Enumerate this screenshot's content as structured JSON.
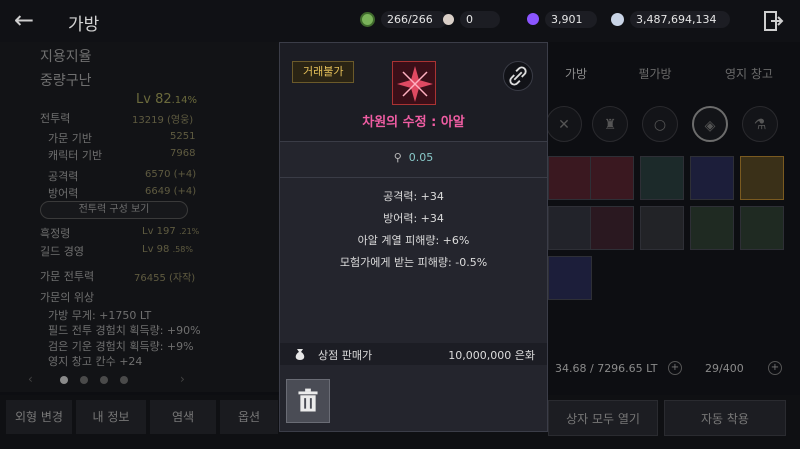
{
  "header": {
    "title": "가방",
    "currencies": [
      {
        "icon": "energy-icon",
        "value": "266/266",
        "color": "#7ab35a"
      },
      {
        "icon": "pearl-icon",
        "value": "0",
        "color": "#d9cfc7"
      },
      {
        "icon": "gem-icon",
        "value": "3,901",
        "color": "#8b55ff"
      },
      {
        "icon": "silver-icon",
        "value": "3,487,694,134",
        "color": "#c9d4e6"
      }
    ]
  },
  "left_panel": {
    "family_name": "지용지율",
    "character_name": "중량구난",
    "level": "Lv 82",
    "level_pct": ".14%",
    "combat_label": "전투력",
    "combat_value": "13219 (영웅)",
    "family_base_label": "가문 기반",
    "family_base_value": "5251",
    "char_base_label": "캐릭터 기반",
    "char_base_value": "7968",
    "attack_label": "공격력",
    "attack_value": "6570 (+4)",
    "defense_label": "방어력",
    "defense_value": "6649 (+4)",
    "stat_button": "전투력 구성 보기",
    "black_spirit_label": "흑정령",
    "black_spirit_value": "Lv 197",
    "black_spirit_pct": ".21%",
    "guild_label": "길드 경영",
    "guild_value": "Lv 98",
    "guild_pct": ".58%",
    "family_combat_label": "가문 전투력",
    "family_combat_value": "76455 (자작)",
    "family_prestige_label": "가문의 위상",
    "bonus_1": "가방 무게: +1750 LT",
    "bonus_2": "필드 전투 경험치 획득량: +90%",
    "bonus_3": "검은 기운 경험치 획득량: +9%",
    "bonus_4": "영지 창고 칸수 +24"
  },
  "bottom_buttons": {
    "appearance": "외형 변경",
    "my_info": "내 정보",
    "dye": "염색",
    "options": "옵션",
    "open_all": "상자 모두 열기",
    "auto_equip": "자동 착용"
  },
  "tabs": [
    "가방",
    "펄가방",
    "영지 창고"
  ],
  "inventory": {
    "weight": "34.68 / 7296.65 LT",
    "count": "29/400"
  },
  "popup": {
    "trade_tag": "거래불가",
    "item_name": "차원의 수정 : 아알",
    "item_weight": "0.05",
    "stats": [
      "공격력: +34",
      "방어력: +34",
      "아알 계열 피해량: +6%",
      "모험가에게 받는 피해량: -0.5%"
    ],
    "sell_label": "상점 판매가",
    "sell_value": "10,000,000 은화"
  }
}
